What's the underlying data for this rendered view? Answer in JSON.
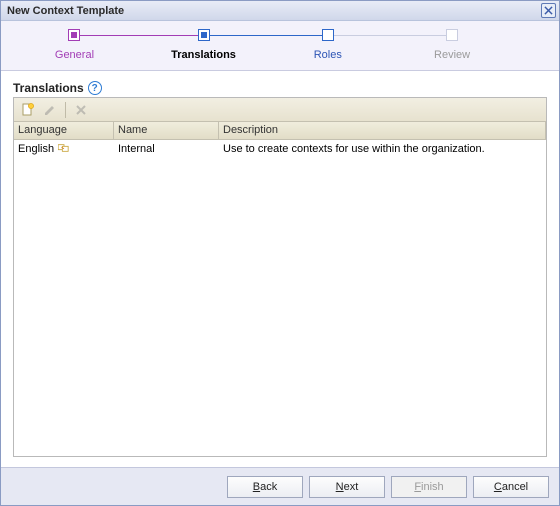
{
  "dialog": {
    "title": "New Context Template"
  },
  "wizard": {
    "steps": {
      "general": "General",
      "translations": "Translations",
      "roles": "Roles",
      "review": "Review"
    }
  },
  "section": {
    "title": "Translations"
  },
  "toolbar": {
    "new": "new-translation",
    "edit": "edit-translation",
    "delete": "delete-translation"
  },
  "columns": {
    "language": "Language",
    "name": "Name",
    "description": "Description"
  },
  "rows": [
    {
      "language": "English",
      "is_master": true,
      "name": "Internal",
      "description": "Use to create contexts for use within the organization."
    }
  ],
  "buttons": {
    "back": {
      "mn": "B",
      "rest": "ack"
    },
    "next": {
      "mn": "N",
      "rest": "ext"
    },
    "finish": {
      "mn": "F",
      "rest": "inish"
    },
    "cancel": {
      "mn": "C",
      "rest": "ancel"
    }
  }
}
